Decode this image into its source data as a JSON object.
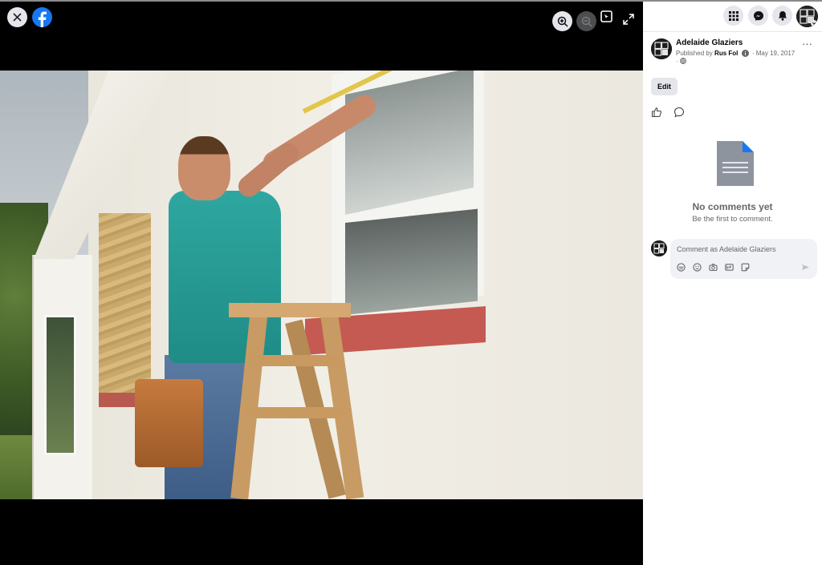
{
  "viewer": {
    "close_icon": "close-icon",
    "brand_icon": "facebook-logo-icon",
    "controls": [
      "zoom-in-icon",
      "zoom-out-icon",
      "tag-icon",
      "fullscreen-icon"
    ]
  },
  "panel": {
    "top_icons": [
      "menu-grid-icon",
      "messenger-icon",
      "notifications-bell-icon",
      "profile-avatar"
    ],
    "post": {
      "page_name": "Adelaide Glaziers",
      "published_by_prefix": "Published by",
      "author": "Rus Fol",
      "date": "· May 19, 2017",
      "meta_line2": "·",
      "more_label": "···",
      "edit_label": "Edit"
    },
    "empty_state": {
      "title": "No comments yet",
      "subtitle": "Be the first to comment."
    },
    "composer": {
      "placeholder": "Comment as Adelaide Glaziers",
      "tools": [
        "avatar-sticker-icon",
        "emoji-icon",
        "camera-icon",
        "gif-icon",
        "sticker-icon"
      ]
    }
  },
  "colors": {
    "brand_blue": "#1877f2",
    "button_gray": "#e4e6eb",
    "secondary_text": "#65676b",
    "input_bg": "#f0f2f5"
  }
}
